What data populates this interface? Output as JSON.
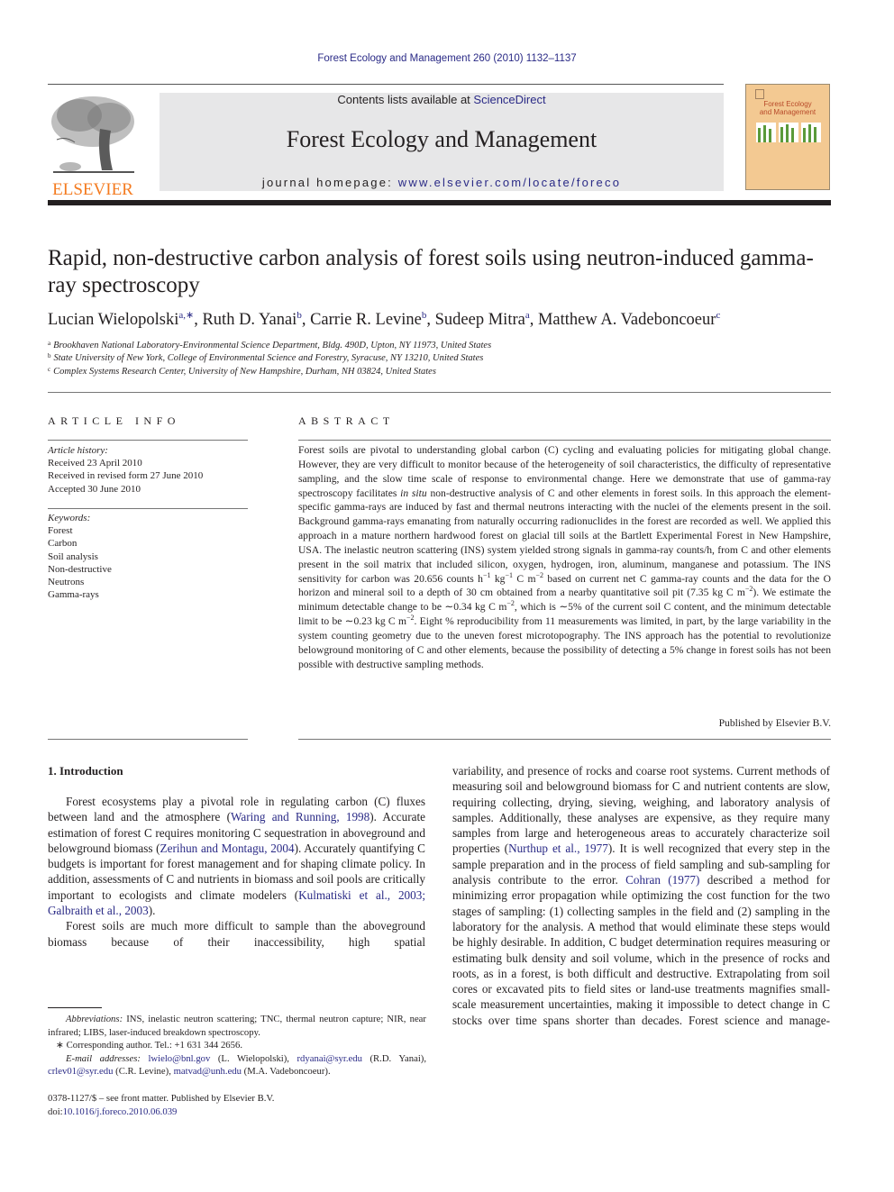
{
  "running_header": "Forest Ecology and Management 260 (2010) 1132–1137",
  "masthead": {
    "publisher_logo_text": "ELSEVIER",
    "contents_prefix": "Contents lists available at ",
    "contents_link": "ScienceDirect",
    "journal_title": "Forest Ecology and Management",
    "homepage_prefix": "journal homepage: ",
    "homepage_url": "www.elsevier.com/locate/foreco",
    "cover_title_line1": "Forest Ecology",
    "cover_title_line2": "and Management",
    "brand_color": "#f47b20",
    "link_color": "#2a2a86"
  },
  "article": {
    "title": "Rapid, non-destructive carbon analysis of forest soils using neutron-induced gamma-ray spectroscopy",
    "authors": [
      {
        "name": "Lucian Wielopolski",
        "sup": "a,∗",
        "sep": ", "
      },
      {
        "name": "Ruth D. Yanai",
        "sup": "b",
        "sep": ", "
      },
      {
        "name": "Carrie R. Levine",
        "sup": "b",
        "sep": ", "
      },
      {
        "name": "Sudeep Mitra",
        "sup": "a",
        "sep": ", "
      },
      {
        "name": "Matthew A. Vadeboncoeur",
        "sup": "c",
        "sep": ""
      }
    ],
    "affiliations": [
      {
        "key": "a",
        "text": "Brookhaven National Laboratory-Environmental Science Department, Bldg. 490D, Upton, NY 11973, United States"
      },
      {
        "key": "b",
        "text": "State University of New York, College of Environmental Science and Forestry, Syracuse, NY 13210, United States"
      },
      {
        "key": "c",
        "text": "Complex Systems Research Center, University of New Hampshire, Durham, NH 03824, United States"
      }
    ]
  },
  "article_info": {
    "heading": "ARTICLE INFO",
    "history_label": "Article history:",
    "history": [
      "Received 23 April 2010",
      "Received in revised form 27 June 2010",
      "Accepted 30 June 2010"
    ],
    "keywords_label": "Keywords:",
    "keywords": [
      "Forest",
      "Carbon",
      "Soil analysis",
      "Non-destructive",
      "Neutrons",
      "Gamma-rays"
    ]
  },
  "abstract": {
    "heading": "ABSTRACT",
    "p1": "Forest soils are pivotal to understanding global carbon (C) cycling and evaluating policies for mitigating global change. However, they are very difficult to monitor because of the heterogeneity of soil characteristics, the difficulty of representative sampling, and the slow time scale of response to environmental change. Here we demonstrate that use of gamma-ray spectroscopy facilitates ",
    "p1_italic": "in situ",
    "p2": " non-destructive analysis of C and other elements in forest soils. In this approach the element-specific gamma-rays are induced by fast and thermal neutrons interacting with the nuclei of the elements present in the soil. Background gamma-rays emanating from naturally occurring radionuclides in the forest are recorded as well. We applied this approach in a mature northern hardwood forest on glacial till soils at the Bartlett Experimental Forest in New Hampshire, USA. The inelastic neutron scattering (INS) system yielded strong signals in gamma-ray counts/h, from C and other elements present in the soil matrix that included silicon, oxygen, hydrogen, iron, aluminum, manganese and potassium. The INS sensitivity for carbon was 20.656 counts h",
    "s1": "−1",
    "p3": " kg",
    "s2": "−1",
    "p4": " C m",
    "s3": "−2",
    "p5": " based on current net C gamma-ray counts and the data for the O horizon and mineral soil to a depth of 30 cm obtained from a nearby quantitative soil pit (7.35 kg C m",
    "s4": "−2",
    "p6": "). We estimate the minimum detectable change to be ∼0.34 kg C m",
    "s5": "−2",
    "p7": ", which is ∼5% of the current soil C content, and the minimum detectable limit to be ∼0.23 kg C m",
    "s6": "−2",
    "p8": ". Eight % reproducibility from 11 measurements was limited, in part, by the large variability in the system counting geometry due to the uneven forest microtopography. The INS approach has the potential to revolutionize belowground monitoring of C and other elements, because the possibility of detecting a 5% change in forest soils has not been possible with destructive sampling methods.",
    "published_by": "Published by Elsevier B.V."
  },
  "introduction": {
    "heading": "1.  Introduction",
    "left": {
      "t1": "Forest ecosystems play a pivotal role in regulating carbon (C) fluxes between land and the atmosphere (",
      "r1": "Waring and Running, 1998",
      "t2": "). Accurate estimation of forest C requires monitoring C sequestration in aboveground and belowground biomass (",
      "r2": "Zerihun and Montagu, 2004",
      "t3": "). Accurately quantifying C budgets is important for forest management and for shaping climate policy. In addition, assessments of C and nutrients in biomass and soil pools are critically important to ecologists and climate modelers (",
      "r3": "Kulmatiski et al., 2003; Galbraith et al., 2003",
      "t4": ").",
      "t5": "Forest soils are much more difficult to sample than the aboveground biomass because of their inaccessibility, high spatial"
    },
    "right": {
      "t1": "variability, and presence of rocks and coarse root systems. Current methods of measuring soil and belowground biomass for C and nutrient contents are slow, requiring collecting, drying, sieving, weighing, and laboratory analysis of samples. Additionally, these analyses are expensive, as they require many samples from large and heterogeneous areas to accurately characterize soil properties (",
      "r1": "Nurthup et al., 1977",
      "t2": "). It is well recognized that every step in the sample preparation and in the process of field sampling and sub-sampling for analysis contribute to the error. ",
      "r2": "Cohran (1977)",
      "t3": " described a method for minimizing error propagation while optimizing the cost function for the two stages of sampling: (1) collecting samples in the field and (2) sampling in the laboratory for the analysis. A method that would eliminate these steps would be highly desirable. In addition, C budget determination requires measuring or estimating bulk density and soil volume, which in the presence of rocks and roots, as in a forest, is both difficult and destructive. Extrapolating from soil cores or excavated pits to field sites or land-use treatments magnifies small-scale measurement uncertainties, making it impossible to detect change in C stocks over time spans shorter than decades. Forest science and manage-"
    }
  },
  "footnotes": {
    "abbr_label": "Abbreviations:",
    "abbr_text": "  INS, inelastic neutron scattering; TNC, thermal neutron capture; NIR, near infrared; LIBS, laser-induced breakdown spectroscopy.",
    "corresponding": "∗  Corresponding author. Tel.: +1 631 344 2656.",
    "email_label": "E-mail addresses:",
    "emails": [
      {
        "addr": "lwielo@bnl.gov",
        "who": " (L. Wielopolski), "
      },
      {
        "addr": "rdyanai@syr.edu",
        "who": " (R.D. Yanai), "
      },
      {
        "addr": "crlev01@syr.edu",
        "who": " (C.R. Levine), "
      },
      {
        "addr": "matvad@unh.edu",
        "who": " (M.A. Vadeboncoeur)."
      }
    ],
    "issn": "0378-1127/$ – see front matter. Published by Elsevier B.V.",
    "doi_prefix": "doi:",
    "doi": "10.1016/j.foreco.2010.06.039"
  }
}
